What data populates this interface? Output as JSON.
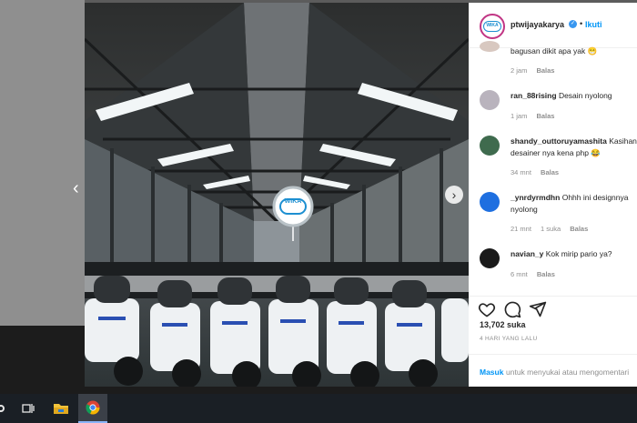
{
  "post": {
    "username": "ptwijayakarya",
    "follow_label": "Ikuti",
    "dot": "•",
    "logo_text": "WIKA",
    "likes": "13,702 suka",
    "time_ago": "4 HARI YANG LALU",
    "login_link": "Masuk",
    "login_text": "untuk menyukai atau mengomentari"
  },
  "comments": [
    {
      "user": "",
      "text": "bagusan dikit apa yak 😁",
      "time": "2 jam",
      "likes": "",
      "reply": "Balas"
    },
    {
      "user": "ran_88rising",
      "text": "Desain nyolong",
      "time": "1 jam",
      "likes": "",
      "reply": "Balas"
    },
    {
      "user": "shandy_outtoruyamashita",
      "text": "Kasihan",
      "line2": "desainer nya kena php 😂",
      "time": "34 mnt",
      "likes": "",
      "reply": "Balas"
    },
    {
      "user": "_ynrdyrmdhn",
      "text": "Ohhh ini designnya",
      "line2": "nyolong",
      "time": "21 mnt",
      "likes": "1 suka",
      "reply": "Balas"
    },
    {
      "user": "navian_y",
      "text": "Kok mirip pario ya?",
      "time": "6 mnt",
      "likes": "",
      "reply": "Balas"
    }
  ],
  "colors": {
    "accent": "#0095f6",
    "brand": "#1d8fd1",
    "verified": "#3897f0"
  },
  "taskbar": {
    "icons": [
      "windows-icon",
      "task-view-icon",
      "file-explorer-icon",
      "chrome-icon"
    ]
  }
}
